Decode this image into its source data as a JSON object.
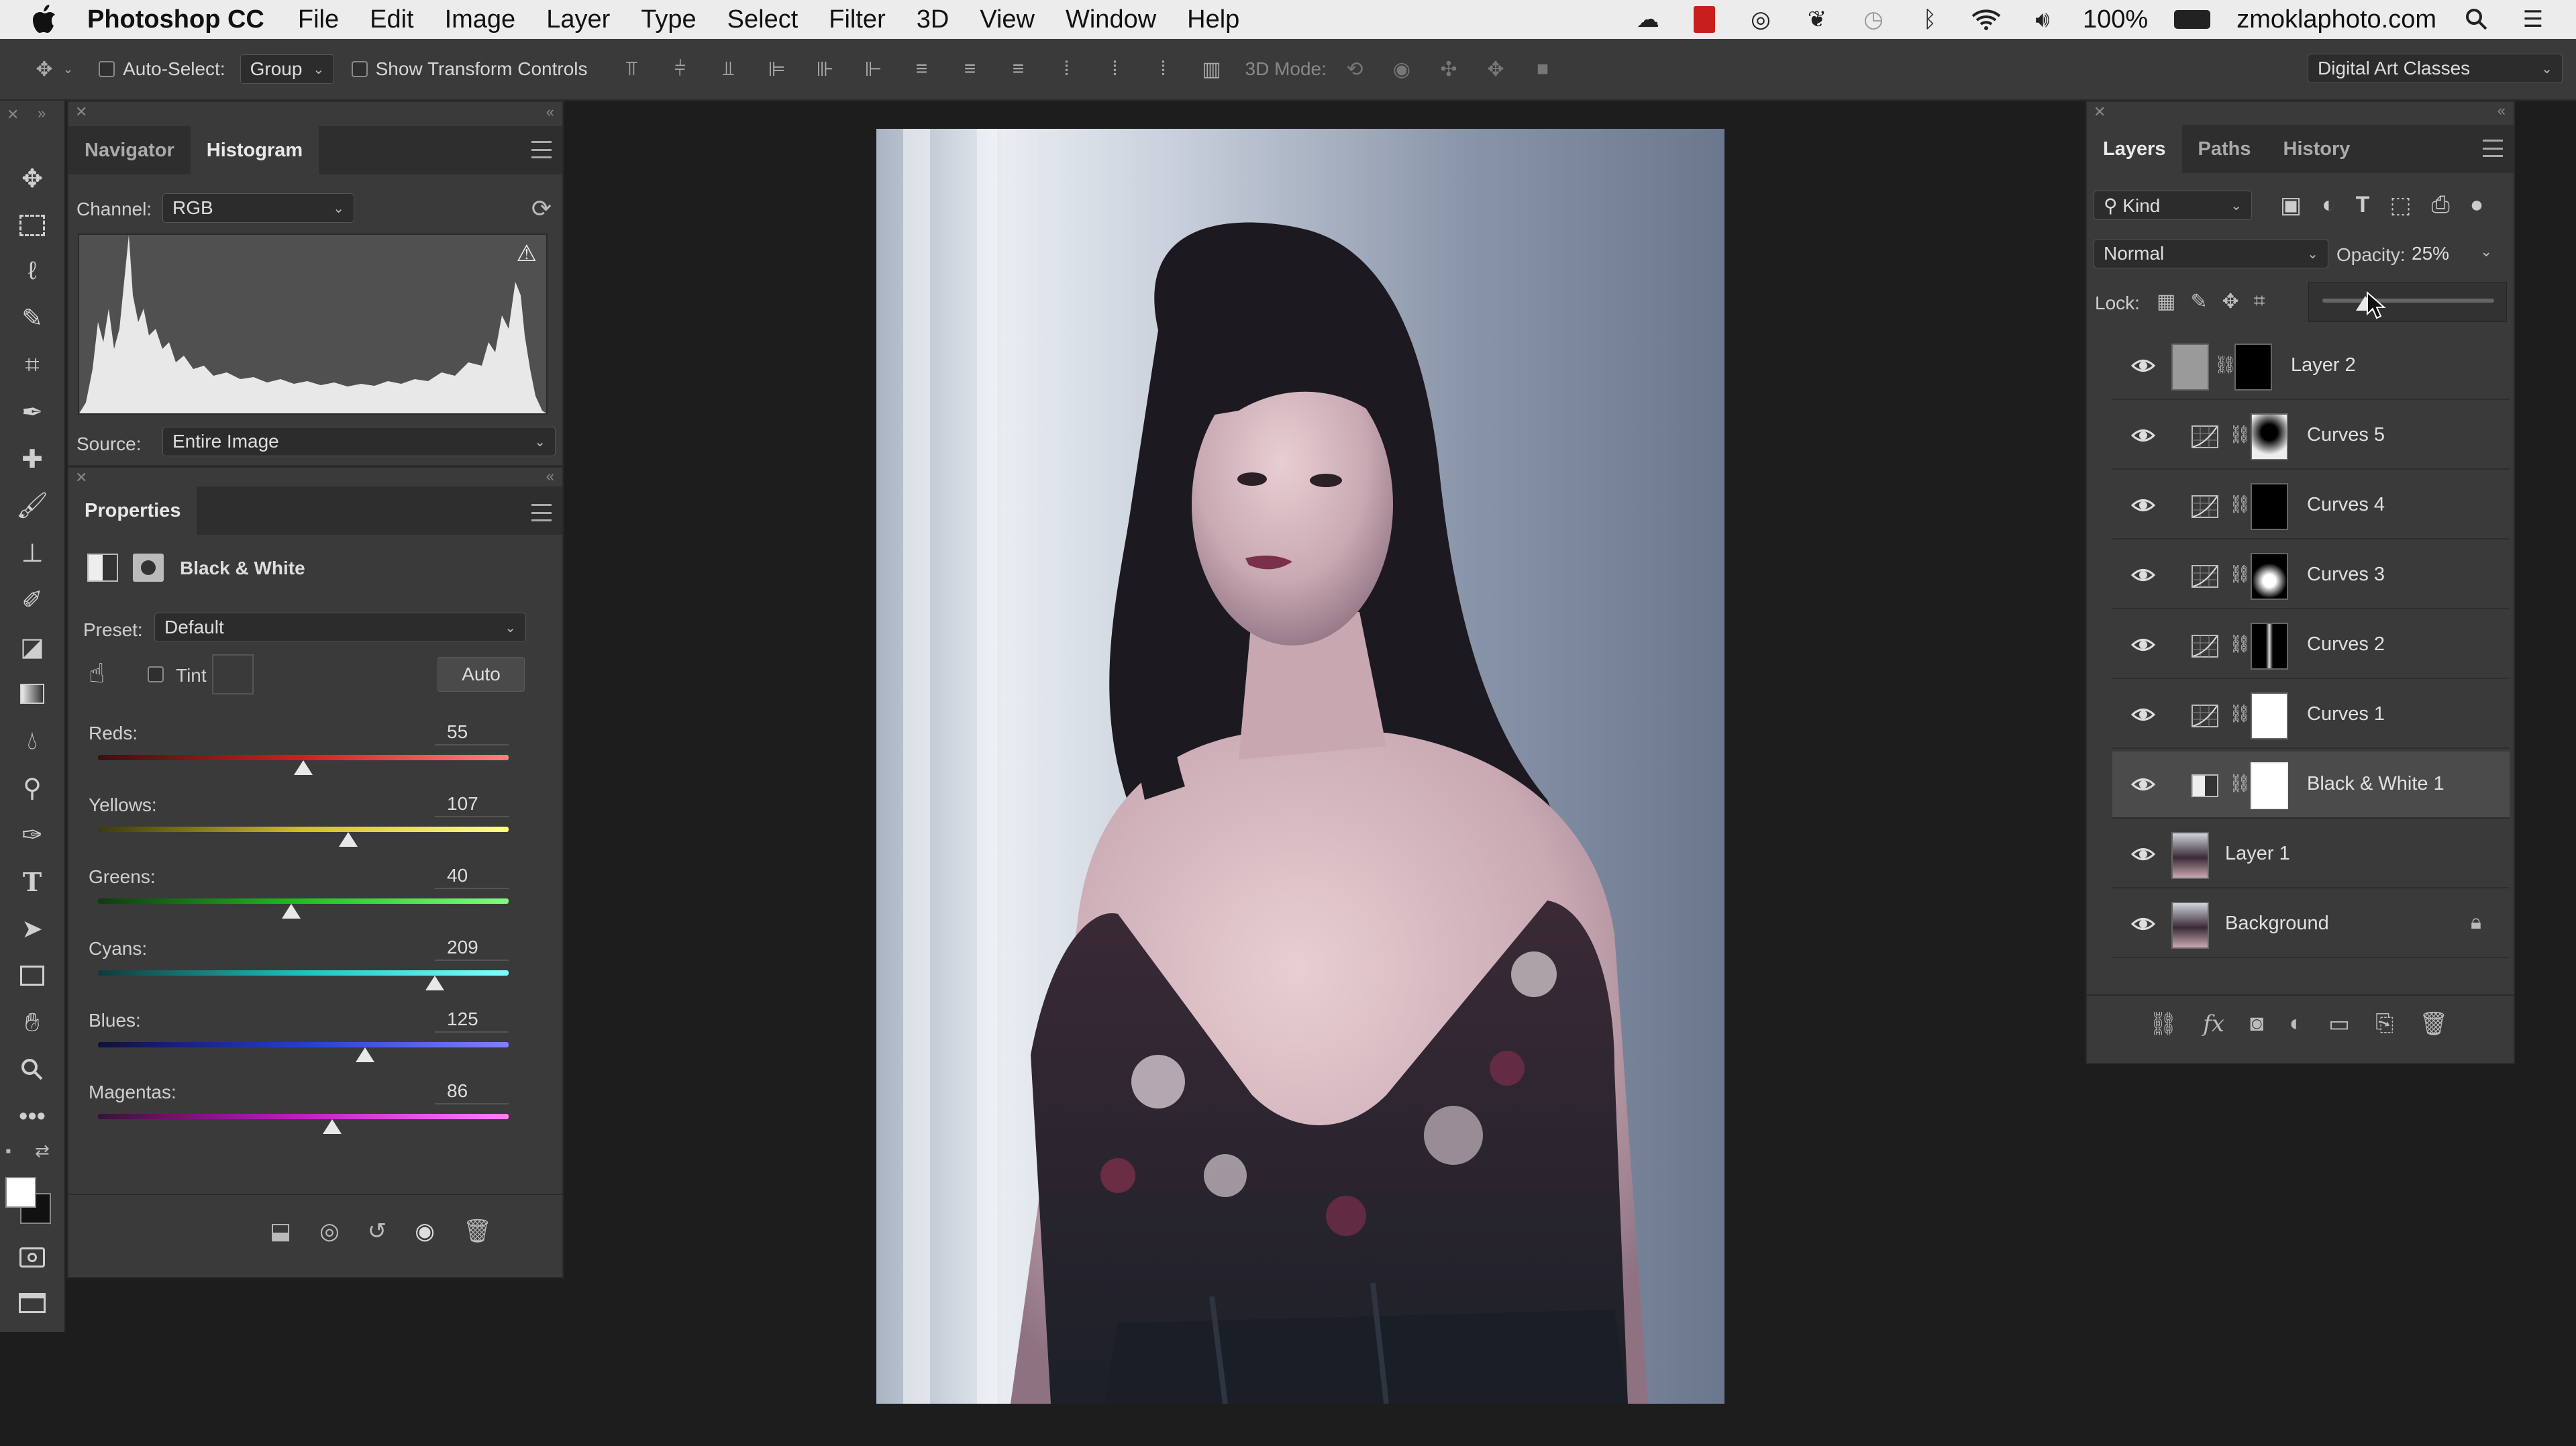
{
  "menubar": {
    "app_name": "Photoshop CC",
    "items": [
      "File",
      "Edit",
      "Image",
      "Layer",
      "Type",
      "Select",
      "Filter",
      "3D",
      "View",
      "Window",
      "Help"
    ],
    "battery": "100%",
    "site": "zmoklaphoto.com"
  },
  "options_bar": {
    "auto_select_label": "Auto-Select:",
    "auto_select_value": "Group",
    "show_transform_label": "Show Transform Controls",
    "mode_3d_label": "3D Mode:",
    "workspace": "Digital Art Classes"
  },
  "histogram_panel": {
    "tabs": [
      "Navigator",
      "Histogram"
    ],
    "active_tab": "Histogram",
    "channel_label": "Channel:",
    "channel_value": "RGB",
    "source_label": "Source:",
    "source_value": "Entire Image"
  },
  "properties_panel": {
    "title": "Properties",
    "adjustment_name": "Black & White",
    "preset_label": "Preset:",
    "preset_value": "Default",
    "tint_label": "Tint",
    "auto_label": "Auto",
    "sliders": [
      {
        "label": "Reds:",
        "value": "55",
        "fraction": 0.5
      },
      {
        "label": "Yellows:",
        "value": "107",
        "fraction": 0.61
      },
      {
        "label": "Greens:",
        "value": "40",
        "fraction": 0.47
      },
      {
        "label": "Cyans:",
        "value": "209",
        "fraction": 0.82
      },
      {
        "label": "Blues:",
        "value": "125",
        "fraction": 0.65
      },
      {
        "label": "Magentas:",
        "value": "86",
        "fraction": 0.57
      }
    ]
  },
  "layers_panel": {
    "tabs": [
      "Layers",
      "Paths",
      "History"
    ],
    "active_tab": "Layers",
    "filter_value": "Kind",
    "blend_mode": "Normal",
    "opacity_label": "Opacity:",
    "opacity_value": "25%",
    "opacity_fraction": 0.25,
    "lock_label": "Lock:",
    "layers": [
      {
        "name": "Layer 2",
        "kind": "pixel-mask",
        "selected": false
      },
      {
        "name": "Curves 5",
        "kind": "curves",
        "selected": false
      },
      {
        "name": "Curves 4",
        "kind": "curves",
        "selected": false
      },
      {
        "name": "Curves 3",
        "kind": "curves",
        "selected": false
      },
      {
        "name": "Curves 2",
        "kind": "curves",
        "selected": false
      },
      {
        "name": "Curves 1",
        "kind": "curves",
        "selected": false
      },
      {
        "name": "Black & White 1",
        "kind": "bw",
        "selected": true
      },
      {
        "name": "Layer 1",
        "kind": "photo",
        "selected": false
      },
      {
        "name": "Background",
        "kind": "photo",
        "selected": false,
        "locked": true
      }
    ]
  },
  "colors": {
    "panel_bg": "#3a3a3b",
    "app_bg": "#1d1d1e",
    "menubar_bg": "#ececec"
  }
}
